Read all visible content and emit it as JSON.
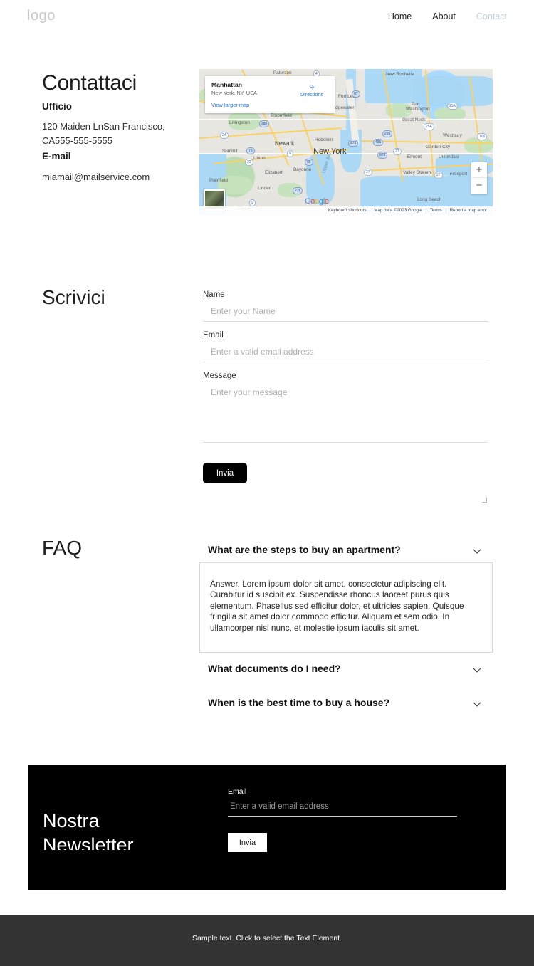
{
  "header": {
    "logo": "logo",
    "nav": [
      {
        "label": "Home",
        "current": false
      },
      {
        "label": "About",
        "current": false
      },
      {
        "label": "Contact",
        "current": true
      }
    ]
  },
  "contact": {
    "heading": "Contattaci",
    "office_label": "Ufficio",
    "address": "120 Maiden LnSan Francisco, CA555-555-5555",
    "email_label": "E-mail",
    "email": "miamail@mailservice.com"
  },
  "map": {
    "card": {
      "title": "Manhattan",
      "subtitle": "New York, NY, USA",
      "view_larger": "View larger map",
      "directions": "Directions"
    },
    "zoom_in": "+",
    "zoom_out": "−",
    "logo": "Google",
    "footer": [
      "Keyboard shortcuts",
      "Map data ©2023 Google",
      "Terms",
      "Report a map error"
    ],
    "labels": [
      "Paterson",
      "New Rochelle",
      "Fort Lee",
      "Edgewater",
      "Bloomfield",
      "Livingston",
      "Port Washington",
      "Great Neck",
      "Westbury",
      "Newark",
      "Hoboken",
      "New York",
      "Garden City",
      "Summit",
      "Elmont",
      "Uniondale",
      "Union",
      "Elizabeth",
      "Bayonne",
      "Valley Stream",
      "Freeport",
      "Plainfield",
      "Linden",
      "Long Beach",
      "Upper Bay",
      "Woodbridge"
    ]
  },
  "write_form": {
    "heading": "Scrivici",
    "name_label": "Name",
    "name_placeholder": "Enter your Name",
    "email_label": "Email",
    "email_placeholder": "Enter a valid email address",
    "message_label": "Message",
    "message_placeholder": "Enter your message",
    "submit_label": "Invia"
  },
  "faq": {
    "heading": "FAQ",
    "items": [
      {
        "question": "What are the steps to buy an apartment?",
        "answer": "Answer. Lorem ipsum dolor sit amet, consectetur adipiscing elit. Curabitur id suscipit ex. Suspendisse rhoncus laoreet purus quis elementum. Phasellus sed efficitur dolor, et ultricies sapien. Quisque fringilla sit amet dolor commodo efficitur. Aliquam et sem odio. In ullamcorper nisi nunc, et molestie ipsum iaculis sit amet.",
        "expanded": true
      },
      {
        "question": "What documents do I need?",
        "expanded": false
      },
      {
        "question": "When is the best time to buy a house?",
        "expanded": false
      }
    ]
  },
  "newsletter": {
    "title_line1": "Nostra",
    "title_line2": "Newsletter",
    "email_label": "Email",
    "email_placeholder": "Enter a valid email address",
    "submit_label": "Invia"
  },
  "footer": {
    "text": "Sample text. Click to select the Text Element."
  }
}
